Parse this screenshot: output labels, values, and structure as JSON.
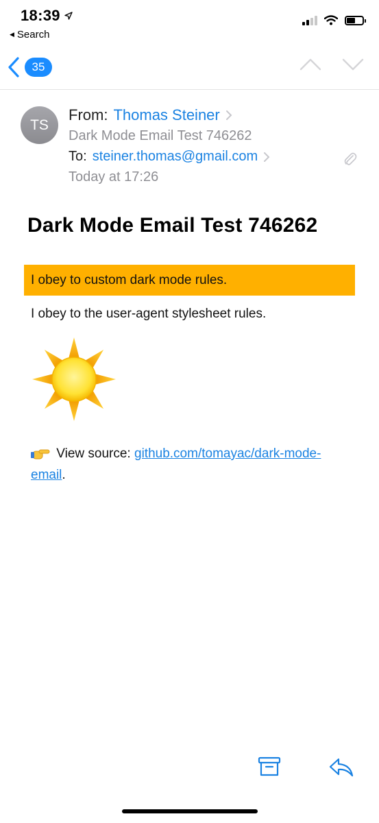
{
  "status_bar": {
    "time": "18:39",
    "back_app_label": "Search"
  },
  "nav": {
    "unread_count": "35"
  },
  "header": {
    "avatar_initials": "TS",
    "from_label": "From:",
    "sender_name": "Thomas Steiner",
    "subject": "Dark Mode Email Test 746262",
    "to_label": "To:",
    "to_address": "steiner.thomas@gmail.com",
    "date": "Today at 17:26"
  },
  "body": {
    "title": "Dark Mode Email Test 746262",
    "custom_rules_text": "I obey to custom dark mode rules.",
    "ua_rules_text": "I obey to the user-agent stylesheet rules.",
    "view_source_label": "View source:",
    "source_link_line1": "github.com/tomayac/dark-mode-",
    "source_link_line2": "email",
    "trailing_period": "."
  },
  "icons": {
    "location": "location-arrow-icon",
    "back": "chevron-left-icon",
    "prev": "chevron-up-icon",
    "next": "chevron-down-icon",
    "attachment": "paperclip-icon",
    "sun": "sun-icon",
    "pointing": "pointing-hand-icon",
    "archive": "archive-icon",
    "reply": "reply-icon"
  },
  "colors": {
    "accent": "#1a82e2",
    "badge": "#1a8cff",
    "highlight": "#ffb000",
    "secondary_text": "#8e8e93"
  }
}
